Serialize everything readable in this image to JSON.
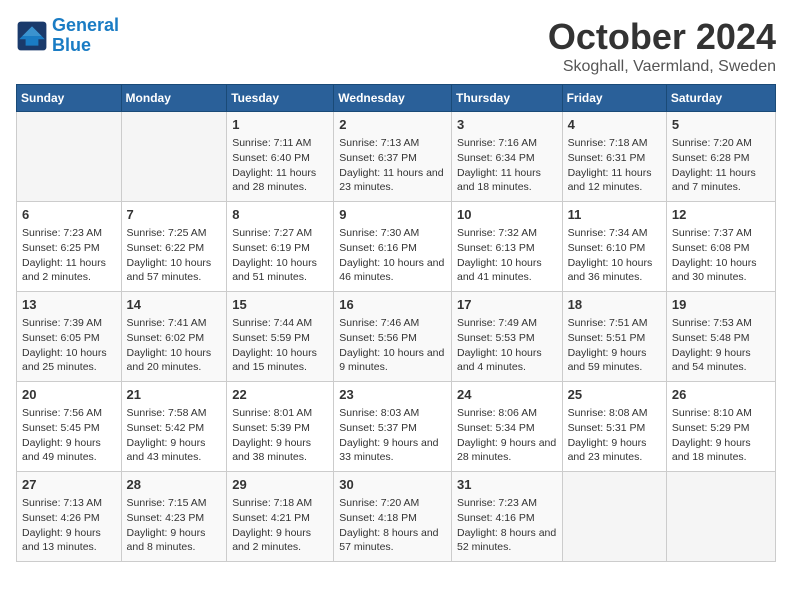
{
  "header": {
    "logo_line1": "General",
    "logo_line2": "Blue",
    "title": "October 2024",
    "subtitle": "Skoghall, Vaermland, Sweden"
  },
  "weekdays": [
    "Sunday",
    "Monday",
    "Tuesday",
    "Wednesday",
    "Thursday",
    "Friday",
    "Saturday"
  ],
  "weeks": [
    [
      {
        "day": "",
        "info": ""
      },
      {
        "day": "",
        "info": ""
      },
      {
        "day": "1",
        "info": "Sunrise: 7:11 AM\nSunset: 6:40 PM\nDaylight: 11 hours and 28 minutes."
      },
      {
        "day": "2",
        "info": "Sunrise: 7:13 AM\nSunset: 6:37 PM\nDaylight: 11 hours and 23 minutes."
      },
      {
        "day": "3",
        "info": "Sunrise: 7:16 AM\nSunset: 6:34 PM\nDaylight: 11 hours and 18 minutes."
      },
      {
        "day": "4",
        "info": "Sunrise: 7:18 AM\nSunset: 6:31 PM\nDaylight: 11 hours and 12 minutes."
      },
      {
        "day": "5",
        "info": "Sunrise: 7:20 AM\nSunset: 6:28 PM\nDaylight: 11 hours and 7 minutes."
      }
    ],
    [
      {
        "day": "6",
        "info": "Sunrise: 7:23 AM\nSunset: 6:25 PM\nDaylight: 11 hours and 2 minutes."
      },
      {
        "day": "7",
        "info": "Sunrise: 7:25 AM\nSunset: 6:22 PM\nDaylight: 10 hours and 57 minutes."
      },
      {
        "day": "8",
        "info": "Sunrise: 7:27 AM\nSunset: 6:19 PM\nDaylight: 10 hours and 51 minutes."
      },
      {
        "day": "9",
        "info": "Sunrise: 7:30 AM\nSunset: 6:16 PM\nDaylight: 10 hours and 46 minutes."
      },
      {
        "day": "10",
        "info": "Sunrise: 7:32 AM\nSunset: 6:13 PM\nDaylight: 10 hours and 41 minutes."
      },
      {
        "day": "11",
        "info": "Sunrise: 7:34 AM\nSunset: 6:10 PM\nDaylight: 10 hours and 36 minutes."
      },
      {
        "day": "12",
        "info": "Sunrise: 7:37 AM\nSunset: 6:08 PM\nDaylight: 10 hours and 30 minutes."
      }
    ],
    [
      {
        "day": "13",
        "info": "Sunrise: 7:39 AM\nSunset: 6:05 PM\nDaylight: 10 hours and 25 minutes."
      },
      {
        "day": "14",
        "info": "Sunrise: 7:41 AM\nSunset: 6:02 PM\nDaylight: 10 hours and 20 minutes."
      },
      {
        "day": "15",
        "info": "Sunrise: 7:44 AM\nSunset: 5:59 PM\nDaylight: 10 hours and 15 minutes."
      },
      {
        "day": "16",
        "info": "Sunrise: 7:46 AM\nSunset: 5:56 PM\nDaylight: 10 hours and 9 minutes."
      },
      {
        "day": "17",
        "info": "Sunrise: 7:49 AM\nSunset: 5:53 PM\nDaylight: 10 hours and 4 minutes."
      },
      {
        "day": "18",
        "info": "Sunrise: 7:51 AM\nSunset: 5:51 PM\nDaylight: 9 hours and 59 minutes."
      },
      {
        "day": "19",
        "info": "Sunrise: 7:53 AM\nSunset: 5:48 PM\nDaylight: 9 hours and 54 minutes."
      }
    ],
    [
      {
        "day": "20",
        "info": "Sunrise: 7:56 AM\nSunset: 5:45 PM\nDaylight: 9 hours and 49 minutes."
      },
      {
        "day": "21",
        "info": "Sunrise: 7:58 AM\nSunset: 5:42 PM\nDaylight: 9 hours and 43 minutes."
      },
      {
        "day": "22",
        "info": "Sunrise: 8:01 AM\nSunset: 5:39 PM\nDaylight: 9 hours and 38 minutes."
      },
      {
        "day": "23",
        "info": "Sunrise: 8:03 AM\nSunset: 5:37 PM\nDaylight: 9 hours and 33 minutes."
      },
      {
        "day": "24",
        "info": "Sunrise: 8:06 AM\nSunset: 5:34 PM\nDaylight: 9 hours and 28 minutes."
      },
      {
        "day": "25",
        "info": "Sunrise: 8:08 AM\nSunset: 5:31 PM\nDaylight: 9 hours and 23 minutes."
      },
      {
        "day": "26",
        "info": "Sunrise: 8:10 AM\nSunset: 5:29 PM\nDaylight: 9 hours and 18 minutes."
      }
    ],
    [
      {
        "day": "27",
        "info": "Sunrise: 7:13 AM\nSunset: 4:26 PM\nDaylight: 9 hours and 13 minutes."
      },
      {
        "day": "28",
        "info": "Sunrise: 7:15 AM\nSunset: 4:23 PM\nDaylight: 9 hours and 8 minutes."
      },
      {
        "day": "29",
        "info": "Sunrise: 7:18 AM\nSunset: 4:21 PM\nDaylight: 9 hours and 2 minutes."
      },
      {
        "day": "30",
        "info": "Sunrise: 7:20 AM\nSunset: 4:18 PM\nDaylight: 8 hours and 57 minutes."
      },
      {
        "day": "31",
        "info": "Sunrise: 7:23 AM\nSunset: 4:16 PM\nDaylight: 8 hours and 52 minutes."
      },
      {
        "day": "",
        "info": ""
      },
      {
        "day": "",
        "info": ""
      }
    ]
  ]
}
